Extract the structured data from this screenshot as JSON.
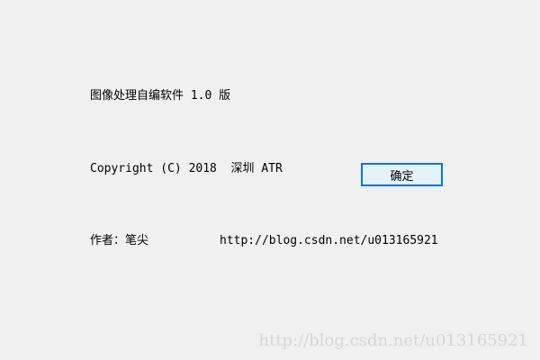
{
  "about": {
    "title_text": "图像处理自编软件 1.0 版",
    "copyright_text": "Copyright (C) 2018  深圳 ATR",
    "author_text": "作者：笔尖",
    "blog_url": "http://blog.csdn.net/u013165921"
  },
  "buttons": {
    "ok_label": "确定"
  },
  "watermark": {
    "text": "http://blog.csdn.net/u013165921"
  },
  "colors": {
    "background": "#f0f0f0",
    "button_border": "#0078d7",
    "button_fill": "#e5f1fb",
    "watermark": "#d6d6d6"
  }
}
